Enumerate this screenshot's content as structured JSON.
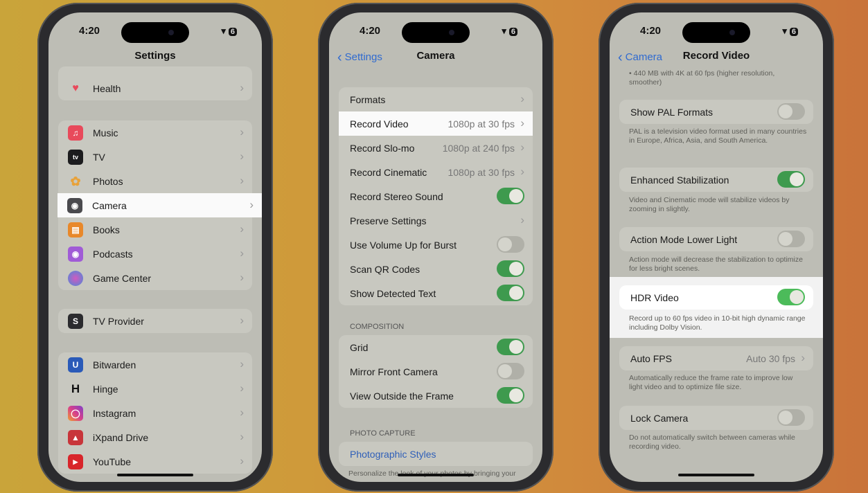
{
  "status": {
    "time": "4:20",
    "wifi": "≡",
    "battery": "6"
  },
  "phone1": {
    "title": "Settings",
    "items_top": [
      {
        "label": "Health",
        "icon": "heart-icon",
        "color": "#ffffff"
      }
    ],
    "items_apps": [
      {
        "label": "Music",
        "icon": "music-icon",
        "color": "#e84a5b"
      },
      {
        "label": "TV",
        "icon": "tv-icon",
        "color": "#1c1c1e"
      },
      {
        "label": "Photos",
        "icon": "photos-icon",
        "color": "#e8a23a"
      },
      {
        "label": "Camera",
        "icon": "camera-icon",
        "color": "#8a8a8e"
      },
      {
        "label": "Books",
        "icon": "books-icon",
        "color": "#e8882a"
      },
      {
        "label": "Podcasts",
        "icon": "podcasts-icon",
        "color": "#a05bd6"
      },
      {
        "label": "Game Center",
        "icon": "game-center-icon",
        "color": "#d05ac0"
      }
    ],
    "items_provider": [
      {
        "label": "TV Provider",
        "icon": "tv-provider-icon",
        "color": "#2b2b2e"
      }
    ],
    "items_third": [
      {
        "label": "Bitwarden",
        "icon": "bitwarden-icon",
        "color": "#2a5ab8"
      },
      {
        "label": "Hinge",
        "icon": "hinge-icon",
        "color": "#bdbdb5"
      },
      {
        "label": "Instagram",
        "icon": "instagram-icon",
        "color": "#d8408a"
      },
      {
        "label": "iXpand Drive",
        "icon": "ixpand-icon",
        "color": "#c8353a"
      },
      {
        "label": "YouTube",
        "icon": "youtube-icon",
        "color": "#d8252a"
      }
    ]
  },
  "phone2": {
    "back": "Settings",
    "title": "Camera",
    "group1": [
      {
        "label": "Formats",
        "value": "",
        "type": "nav"
      },
      {
        "label": "Record Video",
        "value": "1080p at 30 fps",
        "type": "nav"
      },
      {
        "label": "Record Slo-mo",
        "value": "1080p at 240 fps",
        "type": "nav"
      },
      {
        "label": "Record Cinematic",
        "value": "1080p at 30 fps",
        "type": "nav"
      },
      {
        "label": "Record Stereo Sound",
        "value": "",
        "type": "on"
      },
      {
        "label": "Preserve Settings",
        "value": "",
        "type": "nav"
      },
      {
        "label": "Use Volume Up for Burst",
        "value": "",
        "type": "off"
      },
      {
        "label": "Scan QR Codes",
        "value": "",
        "type": "on"
      },
      {
        "label": "Show Detected Text",
        "value": "",
        "type": "on"
      }
    ],
    "composition_header": "COMPOSITION",
    "group2": [
      {
        "label": "Grid",
        "type": "on"
      },
      {
        "label": "Mirror Front Camera",
        "type": "off"
      },
      {
        "label": "View Outside the Frame",
        "type": "on"
      }
    ],
    "photo_header": "PHOTO CAPTURE",
    "photographic_styles": "Photographic Styles",
    "photo_footer": "Personalize the look of your photos by bringing your"
  },
  "phone3": {
    "back": "Camera",
    "title": "Record Video",
    "top_footer": "• 440 MB with 4K at 60 fps (higher resolution, smoother)",
    "pal": {
      "label": "Show PAL Formats",
      "footer": "PAL is a television video format used in many countries in Europe, Africa, Asia, and South America."
    },
    "stab": {
      "label": "Enhanced Stabilization",
      "footer": "Video and Cinematic mode will stabilize videos by zooming in slightly."
    },
    "action": {
      "label": "Action Mode Lower Light",
      "footer": "Action mode will decrease the stabilization to optimize for less bright scenes."
    },
    "hdr": {
      "label": "HDR Video",
      "footer": "Record up to 60 fps video in 10-bit high dynamic range including Dolby Vision."
    },
    "autofps": {
      "label": "Auto FPS",
      "value": "Auto 30 fps",
      "footer": "Automatically reduce the frame rate to improve low light video and to optimize file size."
    },
    "lock": {
      "label": "Lock Camera",
      "footer": "Do not automatically switch between cameras while recording video."
    }
  }
}
